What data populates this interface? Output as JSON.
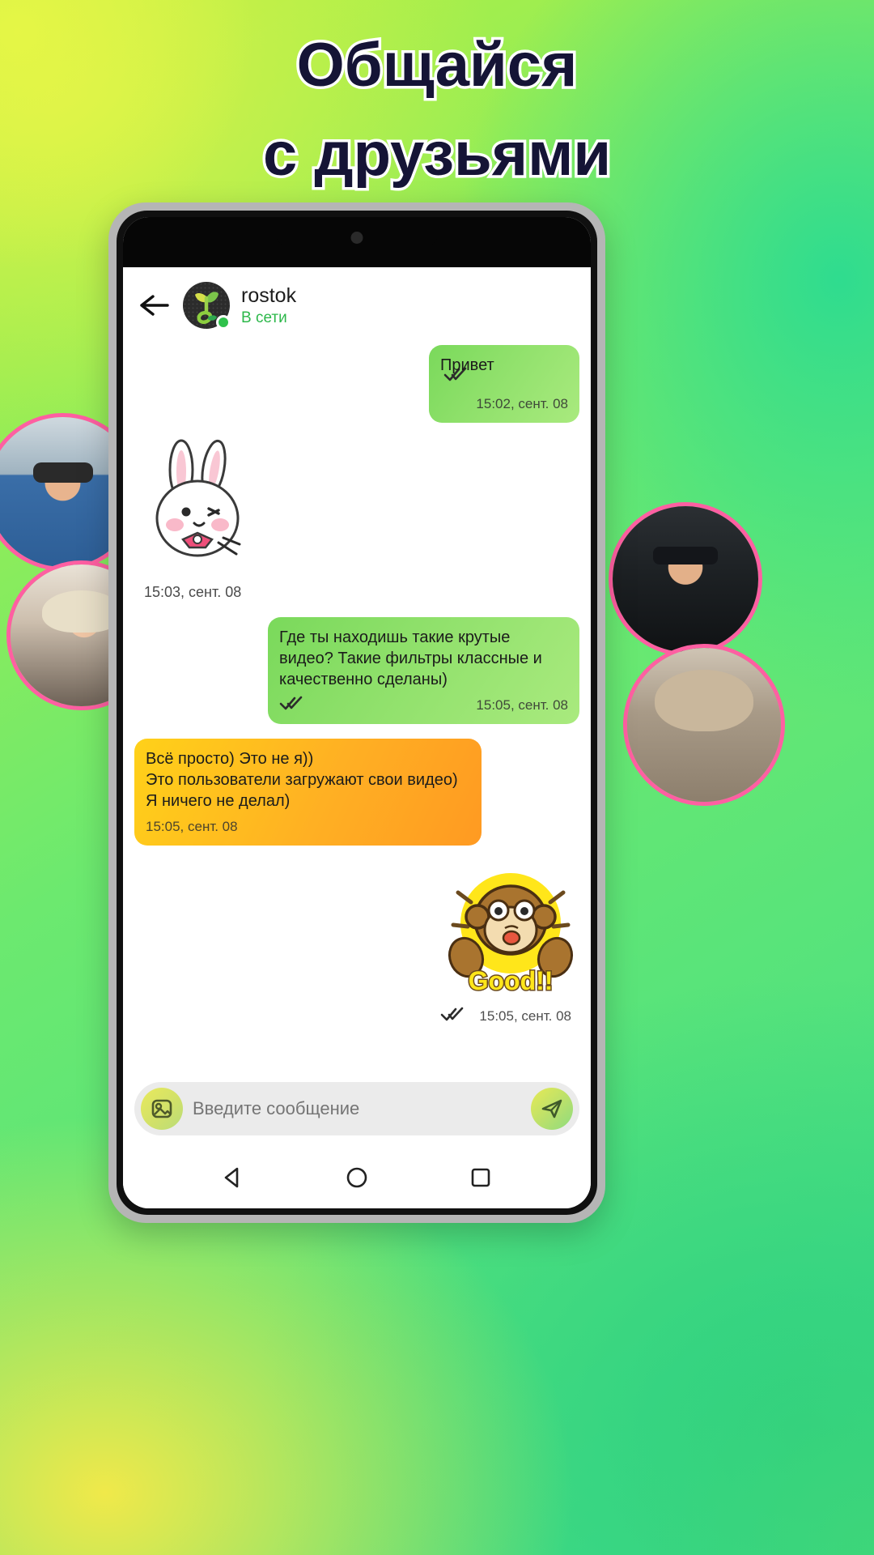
{
  "promo": {
    "headline_line1": "Общайся",
    "headline_line2": "с друзьями",
    "headline_color": "#151436",
    "headline_outline": "#ffffff",
    "background_colors": [
      "#d8f24a",
      "#8ee86a",
      "#2fd080",
      "#f0e94a"
    ]
  },
  "side_photos": [
    {
      "name": "photo-left-1",
      "alt": "man in denim jacket with sunglasses"
    },
    {
      "name": "photo-left-2",
      "alt": "blonde woman with headphones"
    },
    {
      "name": "photo-right-1",
      "alt": "bearded man with glasses"
    },
    {
      "name": "photo-right-2",
      "alt": "woman with long hair"
    }
  ],
  "chat": {
    "back_icon": "arrow-left-icon",
    "avatar_icon": "rostok-sprout-logo",
    "peer_name": "rostok",
    "peer_status": "В сети",
    "status_color": "#2cb84a",
    "online_dot_color": "#2fc14b",
    "messages": [
      {
        "id": "m1",
        "direction": "out",
        "kind": "text",
        "text": "Привет",
        "time": "15:02, сент. 08",
        "ticks": "double-check-icon",
        "bubble_color": "#8ee06a"
      },
      {
        "id": "m2",
        "direction": "in",
        "kind": "sticker",
        "sticker": "bunny-sticker",
        "time": "15:03, сент. 08"
      },
      {
        "id": "m3",
        "direction": "out",
        "kind": "text",
        "text": "Где ты находишь такие крутые видео? Такие фильтры классные и качественно сделаны)",
        "time": "15:05, сент. 08",
        "ticks": "double-check-icon",
        "bubble_color": "#8ee06a"
      },
      {
        "id": "m4",
        "direction": "in",
        "kind": "text",
        "text": "Всё просто) Это не я))\nЭто пользователи загружают свои видео) Я ничего не делал)",
        "time": "15:05, сент. 08",
        "bubble_color": "#ffb023"
      },
      {
        "id": "m5",
        "direction": "out",
        "kind": "sticker",
        "sticker": "monkey-good-sticker",
        "sticker_label": "Good!!",
        "time": "15:05, сент. 08",
        "ticks": "double-check-icon"
      }
    ],
    "input": {
      "placeholder": "Введите сообщение",
      "value": "",
      "attach_icon": "image-icon",
      "send_icon": "send-icon"
    }
  },
  "navbar": {
    "back_icon": "triangle-back-icon",
    "home_icon": "circle-home-icon",
    "recents_icon": "square-recents-icon"
  }
}
